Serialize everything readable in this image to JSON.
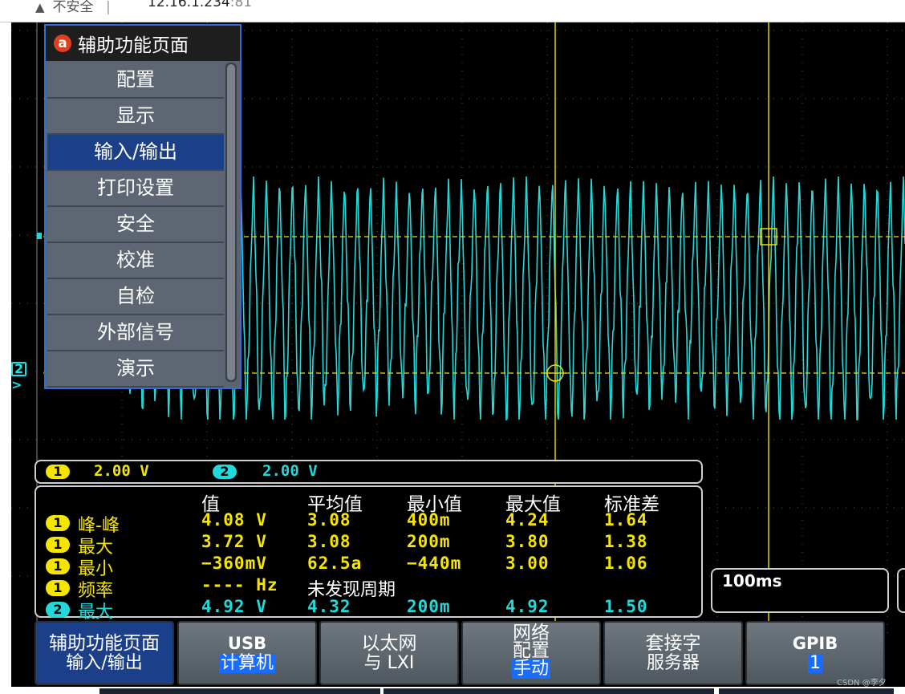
{
  "browser": {
    "security_label": "不安全",
    "separator": "|",
    "url_host": "12.16.1.234",
    "url_port": ":81",
    "warning_icon": "warning-triangle-icon"
  },
  "colors": {
    "ch1": "#f5e600",
    "ch2": "#22d8d8",
    "menu_active": "#1b3f88",
    "menu_item": "#5d6672",
    "cursor": "#f0e000"
  },
  "side_menu": {
    "badge": "a",
    "title": "辅助功能页面",
    "items": [
      {
        "label": "配置",
        "active": false
      },
      {
        "label": "显示",
        "active": false
      },
      {
        "label": "输入/输出",
        "active": true
      },
      {
        "label": "打印设置",
        "active": false
      },
      {
        "label": "安全",
        "active": false
      },
      {
        "label": "校准",
        "active": false
      },
      {
        "label": "自检",
        "active": false
      },
      {
        "label": "外部信号",
        "active": false
      },
      {
        "label": "演示",
        "active": false
      }
    ]
  },
  "channel_marker": {
    "label": "2"
  },
  "scale_bar": {
    "ch1": {
      "badge": "1",
      "value": "2.00 V"
    },
    "ch2": {
      "badge": "2",
      "value": "2.00 V"
    }
  },
  "measurements": {
    "headers": [
      "值",
      "平均值",
      "最小值",
      "最大值",
      "标准差"
    ],
    "rows": [
      {
        "ch": "1",
        "name": "峰-峰",
        "value": "4.08 V",
        "mean": "3.08",
        "min": "400m",
        "max": "4.24",
        "std": "1.64"
      },
      {
        "ch": "1",
        "name": "最大",
        "value": "3.72 V",
        "mean": "3.08",
        "min": "200m",
        "max": "3.80",
        "std": "1.38"
      },
      {
        "ch": "1",
        "name": "最小",
        "value": "−360mV",
        "mean": "62.5a",
        "min": "−440m",
        "max": "3.00",
        "std": "1.06"
      },
      {
        "ch": "1",
        "name": "频率",
        "value": "---- Hz",
        "mean": "未发现周期",
        "min": "",
        "max": "",
        "std": ""
      },
      {
        "ch": "2",
        "name": "最大",
        "value": "4.92 V",
        "mean": "4.32",
        "min": "200m",
        "max": "4.92",
        "std": "1.50"
      }
    ]
  },
  "timebase": {
    "value": "100ms"
  },
  "bottom_buttons": [
    {
      "line1": "辅助功能页面",
      "line2": "输入/输出",
      "active": true
    },
    {
      "line1": "USB",
      "line2": "计算机",
      "active": false
    },
    {
      "line1": "以太网",
      "line2": "与 LXI",
      "active": false
    },
    {
      "line1": "网络\n配置",
      "line2": "手动",
      "active": false
    },
    {
      "line1": "套接字",
      "line2": "服务器",
      "active": false
    },
    {
      "line1": "GPIB",
      "line2": "1",
      "active": false
    }
  ],
  "watermark": "CSDN @李夕"
}
